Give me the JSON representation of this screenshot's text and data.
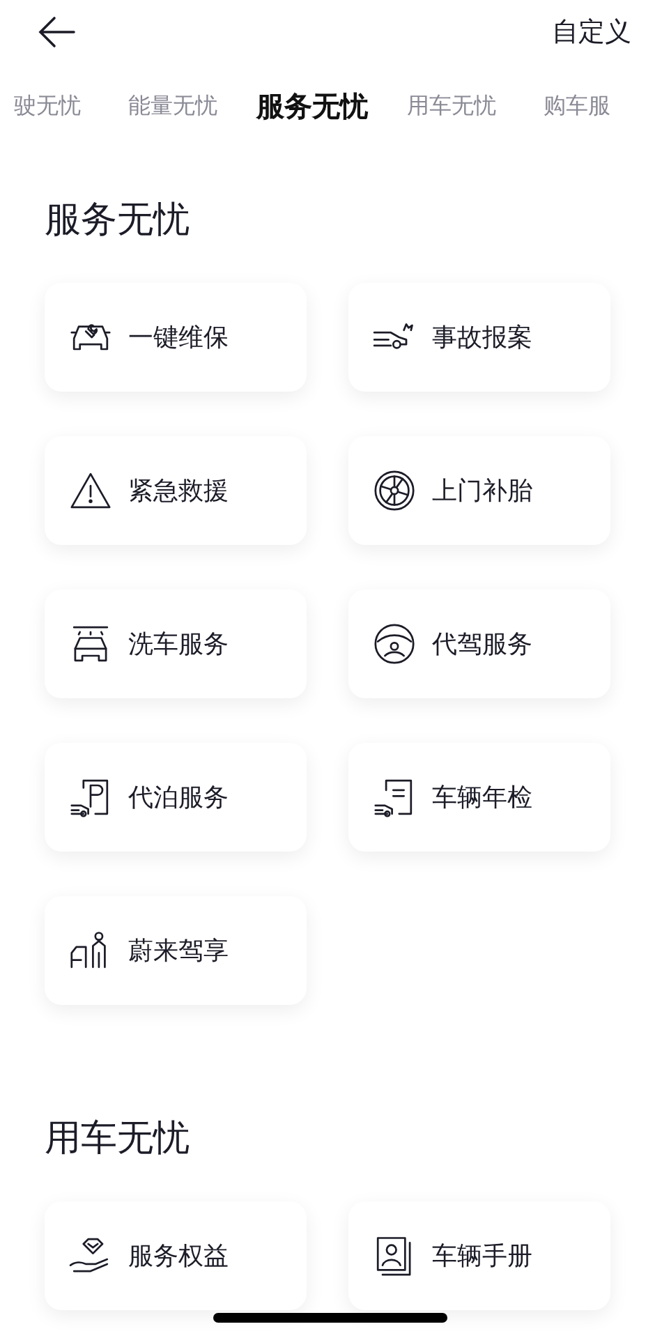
{
  "header": {
    "action": "自定义"
  },
  "tabs": [
    {
      "label": "驶无忧",
      "selected": false
    },
    {
      "label": "能量无忧",
      "selected": false
    },
    {
      "label": "服务无忧",
      "selected": true
    },
    {
      "label": "用车无忧",
      "selected": false
    },
    {
      "label": "购车服",
      "selected": false
    }
  ],
  "sections": [
    {
      "title": "服务无忧",
      "items": [
        {
          "label": "一键维保"
        },
        {
          "label": "事故报案"
        },
        {
          "label": "紧急救援"
        },
        {
          "label": "上门补胎"
        },
        {
          "label": "洗车服务"
        },
        {
          "label": "代驾服务"
        },
        {
          "label": "代泊服务"
        },
        {
          "label": "车辆年检"
        },
        {
          "label": "蔚来驾享"
        }
      ]
    },
    {
      "title": "用车无忧",
      "items": [
        {
          "label": "服务权益"
        },
        {
          "label": "车辆手册"
        }
      ]
    }
  ]
}
